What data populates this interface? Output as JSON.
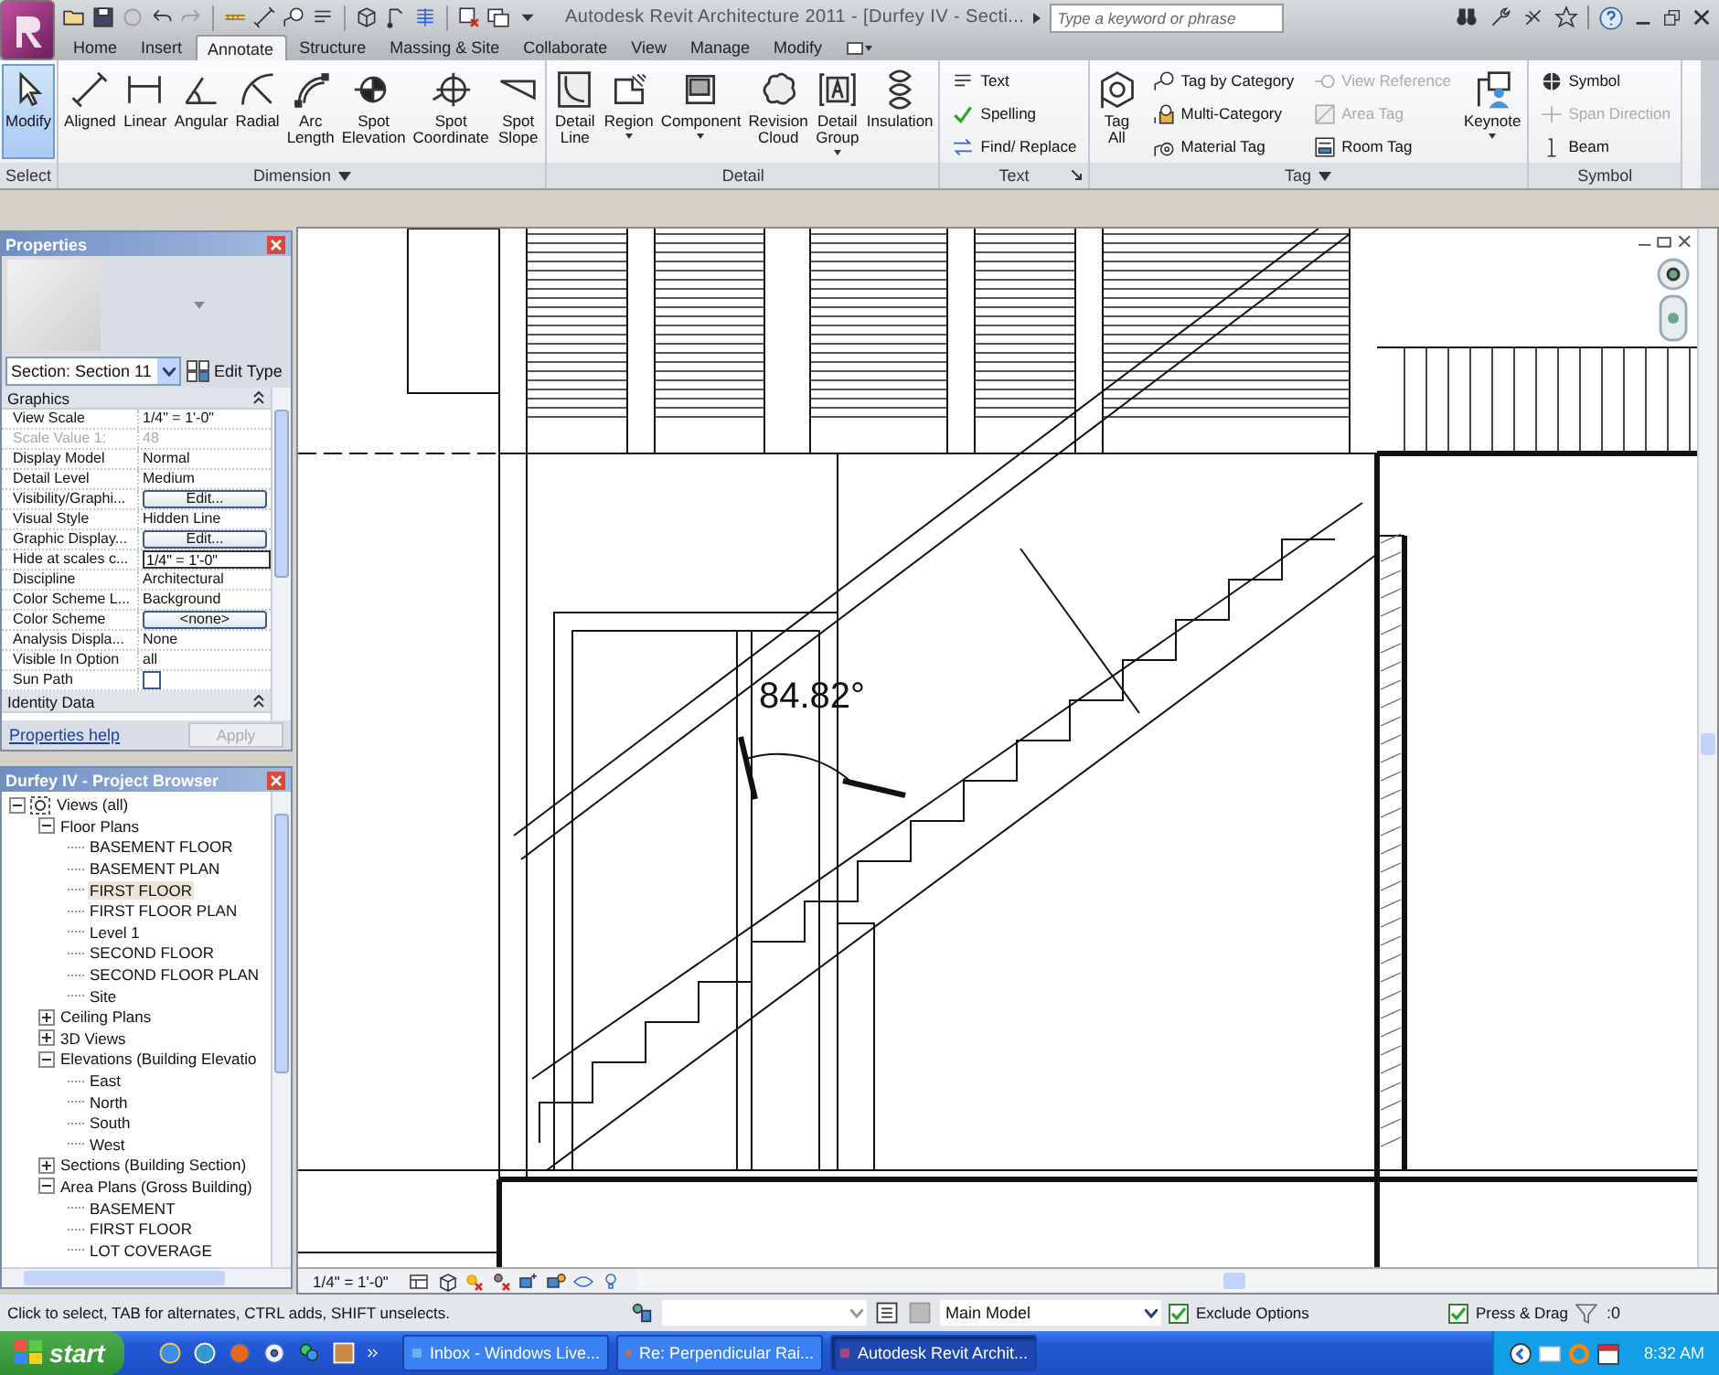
{
  "window": {
    "title": "Autodesk Revit Architecture 2011 - [Durfey IV - Secti...",
    "search_placeholder": "Type a keyword or phrase"
  },
  "tabs": [
    {
      "label": "Home",
      "selected": false
    },
    {
      "label": "Insert",
      "selected": false
    },
    {
      "label": "Annotate",
      "selected": true
    },
    {
      "label": "Structure",
      "selected": false
    },
    {
      "label": "Massing & Site",
      "selected": false
    },
    {
      "label": "Collaborate",
      "selected": false
    },
    {
      "label": "View",
      "selected": false
    },
    {
      "label": "Manage",
      "selected": false
    },
    {
      "label": "Modify",
      "selected": false
    }
  ],
  "ribbon_panels": [
    {
      "label": "Select",
      "menu": false,
      "launcher": false,
      "items": [
        {
          "kind": "large",
          "label": "Modify",
          "selected": true,
          "dropdown": false
        }
      ]
    },
    {
      "label": "Dimension",
      "menu": true,
      "launcher": false,
      "items": [
        {
          "kind": "large",
          "label": "Aligned",
          "selected": false,
          "dropdown": false
        },
        {
          "kind": "large",
          "label": "Linear",
          "selected": false,
          "dropdown": false
        },
        {
          "kind": "large",
          "label": "Angular",
          "selected": false,
          "dropdown": false
        },
        {
          "kind": "large",
          "label": "Radial",
          "selected": false,
          "dropdown": false
        },
        {
          "kind": "large",
          "label": "Arc\nLength",
          "selected": false,
          "dropdown": false
        },
        {
          "kind": "large",
          "label": "Spot\nElevation",
          "selected": false,
          "dropdown": false
        },
        {
          "kind": "large",
          "label": "Spot\nCoordinate",
          "selected": false,
          "dropdown": false
        },
        {
          "kind": "large",
          "label": "Spot\nSlope",
          "selected": false,
          "dropdown": false
        }
      ]
    },
    {
      "label": "Detail",
      "menu": false,
      "launcher": false,
      "items": [
        {
          "kind": "large",
          "label": "Detail\nLine",
          "selected": false,
          "dropdown": false
        },
        {
          "kind": "large",
          "label": "Region",
          "selected": false,
          "dropdown": true
        },
        {
          "kind": "large",
          "label": "Component",
          "selected": false,
          "dropdown": true
        },
        {
          "kind": "large",
          "label": "Revision\nCloud",
          "selected": false,
          "dropdown": false
        },
        {
          "kind": "large",
          "label": "Detail\nGroup",
          "selected": false,
          "dropdown": true
        },
        {
          "kind": "large",
          "label": "Insulation",
          "selected": false,
          "dropdown": false
        }
      ]
    },
    {
      "label": "Text",
      "menu": false,
      "launcher": true,
      "items": [
        {
          "kind": "stack",
          "tools": [
            {
              "label": "Text",
              "disabled": false
            },
            {
              "label": "Spelling",
              "disabled": false
            },
            {
              "label": "Find/ Replace",
              "disabled": false
            }
          ]
        }
      ]
    },
    {
      "label": "Tag",
      "menu": true,
      "launcher": false,
      "items": [
        {
          "kind": "large",
          "label": "Tag\nAll",
          "selected": false,
          "dropdown": false
        },
        {
          "kind": "stack",
          "tools": [
            {
              "label": "Tag by Category",
              "disabled": false
            },
            {
              "label": "Multi-Category",
              "disabled": false
            },
            {
              "label": "Material Tag",
              "disabled": false
            }
          ]
        },
        {
          "kind": "stack",
          "tools": [
            {
              "label": "View Reference",
              "disabled": true
            },
            {
              "label": "Area Tag",
              "disabled": true
            },
            {
              "label": "Room Tag",
              "disabled": false
            }
          ]
        },
        {
          "kind": "large",
          "label": "Keynote",
          "selected": false,
          "dropdown": true
        }
      ]
    },
    {
      "label": "Symbol",
      "menu": false,
      "launcher": false,
      "items": [
        {
          "kind": "stack",
          "tools": [
            {
              "label": "Symbol",
              "disabled": false
            },
            {
              "label": "Span Direction",
              "disabled": true
            },
            {
              "label": "Beam",
              "disabled": false
            }
          ]
        }
      ]
    }
  ],
  "properties": {
    "title": "Properties",
    "type_selector": "Section: Section 11",
    "edit_type": "Edit Type",
    "groups": [
      {
        "name": "Graphics",
        "expanded": true,
        "rows": [
          {
            "name": "View Scale",
            "value": "1/4\" = 1'-0\"",
            "kind": "text",
            "disabled": false
          },
          {
            "name": "Scale Value 1:",
            "value": "48",
            "kind": "text",
            "disabled": true
          },
          {
            "name": "Display Model",
            "value": "Normal",
            "kind": "text",
            "disabled": false
          },
          {
            "name": "Detail Level",
            "value": "Medium",
            "kind": "text",
            "disabled": false
          },
          {
            "name": "Visibility/Graphi...",
            "value": "Edit...",
            "kind": "button",
            "disabled": false
          },
          {
            "name": "Visual Style",
            "value": "Hidden Line",
            "kind": "text",
            "disabled": false
          },
          {
            "name": "Graphic Display...",
            "value": "Edit...",
            "kind": "button",
            "disabled": false
          },
          {
            "name": "Hide at scales c...",
            "value": "1/4\" = 1'-0\"",
            "kind": "input",
            "disabled": false
          },
          {
            "name": "Discipline",
            "value": "Architectural",
            "kind": "text",
            "disabled": false
          },
          {
            "name": "Color Scheme L...",
            "value": "Background",
            "kind": "text",
            "disabled": false
          },
          {
            "name": "Color Scheme",
            "value": "<none>",
            "kind": "button",
            "disabled": false
          },
          {
            "name": "Analysis Displa...",
            "value": "None",
            "kind": "text",
            "disabled": false
          },
          {
            "name": "Visible In Option",
            "value": "all",
            "kind": "text",
            "disabled": false
          },
          {
            "name": "Sun Path",
            "kind": "checkbox",
            "checked": false,
            "disabled": false
          }
        ]
      },
      {
        "name": "Identity Data",
        "expanded": true
      }
    ],
    "help_link": "Properties help",
    "apply": "Apply",
    "apply_disabled": true
  },
  "browser": {
    "title": "Durfey IV - Project Browser",
    "tree": [
      {
        "label": "Views (all)",
        "expanded": true,
        "selected": false,
        "children": [
          {
            "label": "Floor Plans",
            "expanded": true,
            "selected": false,
            "children": [
              {
                "label": "BASEMENT FLOOR",
                "selected": false
              },
              {
                "label": "BASEMENT PLAN",
                "selected": false
              },
              {
                "label": "FIRST FLOOR",
                "selected": true
              },
              {
                "label": "FIRST FLOOR PLAN",
                "selected": false
              },
              {
                "label": "Level 1",
                "selected": false
              },
              {
                "label": "SECOND FLOOR",
                "selected": false
              },
              {
                "label": "SECOND FLOOR PLAN",
                "selected": false
              },
              {
                "label": "Site",
                "selected": false
              }
            ]
          },
          {
            "label": "Ceiling Plans",
            "expanded": false,
            "selected": false
          },
          {
            "label": "3D Views",
            "expanded": false,
            "selected": false
          },
          {
            "label": "Elevations (Building Elevatio",
            "expanded": true,
            "selected": false,
            "children": [
              {
                "label": "East",
                "selected": false
              },
              {
                "label": "North",
                "selected": false
              },
              {
                "label": "South",
                "selected": false
              },
              {
                "label": "West",
                "selected": false
              }
            ]
          },
          {
            "label": "Sections (Building Section)",
            "expanded": false,
            "selected": false
          },
          {
            "label": "Area Plans (Gross Building)",
            "expanded": true,
            "selected": false,
            "children": [
              {
                "label": "BASEMENT",
                "selected": false
              },
              {
                "label": "FIRST FLOOR",
                "selected": false
              },
              {
                "label": "LOT COVERAGE",
                "selected": false
              }
            ]
          }
        ]
      }
    ]
  },
  "canvas": {
    "angle_dimension": "84.82°",
    "view_scale": "1/4\" = 1'-0\""
  },
  "status_bar": {
    "message": "Click to select, TAB for alternates, CTRL adds, SHIFT unselects.",
    "design_option": "Main Model",
    "exclude_options": {
      "label": "Exclude Options",
      "checked": true
    },
    "press_drag": {
      "label": "Press & Drag",
      "checked": true
    },
    "filter_count": ":0"
  },
  "taskbar": {
    "start": "start",
    "tasks": [
      {
        "label": "Inbox - Windows Live...",
        "selected": false
      },
      {
        "label": "Re: Perpendicular Rai...",
        "selected": false
      },
      {
        "label": "Autodesk Revit Archit...",
        "selected": true
      }
    ],
    "clock": "8:32 AM"
  }
}
